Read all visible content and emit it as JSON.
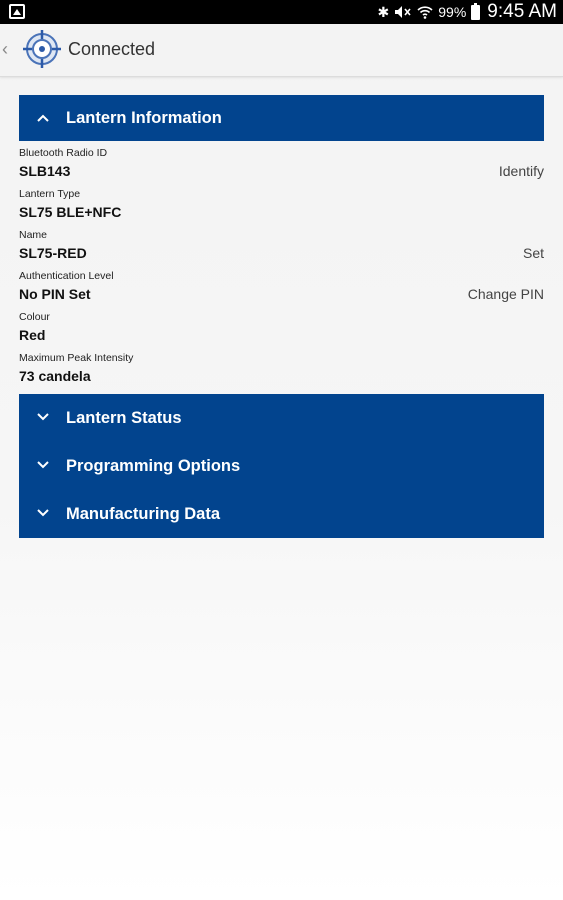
{
  "status_bar": {
    "battery": "99%",
    "time": "9:45 AM",
    "icons": [
      "gallery-icon",
      "bluetooth-icon",
      "mute-icon",
      "wifi-icon",
      "battery-icon"
    ]
  },
  "action_bar": {
    "title": "Connected",
    "logo_icon": "target-compass-icon"
  },
  "sections": {
    "lantern_information": {
      "title": "Lantern Information",
      "expanded": true,
      "fields": [
        {
          "label": "Bluetooth Radio ID",
          "value": "SLB143",
          "action": "Identify"
        },
        {
          "label": "Lantern Type",
          "value": "SL75 BLE+NFC",
          "action": ""
        },
        {
          "label": "Name",
          "value": "SL75-RED",
          "action": "Set"
        },
        {
          "label": "Authentication Level",
          "value": "No PIN Set",
          "action": "Change PIN"
        },
        {
          "label": "Colour",
          "value": "Red",
          "action": ""
        },
        {
          "label": "Maximum Peak Intensity",
          "value": "73 candela",
          "action": ""
        }
      ]
    },
    "lantern_status": {
      "title": "Lantern Status",
      "expanded": false
    },
    "programming_options": {
      "title": "Programming Options",
      "expanded": false
    },
    "manufacturing_data": {
      "title": "Manufacturing Data",
      "expanded": false
    }
  },
  "colors": {
    "header_blue": "#02448e",
    "background": "#f3f3f3"
  }
}
